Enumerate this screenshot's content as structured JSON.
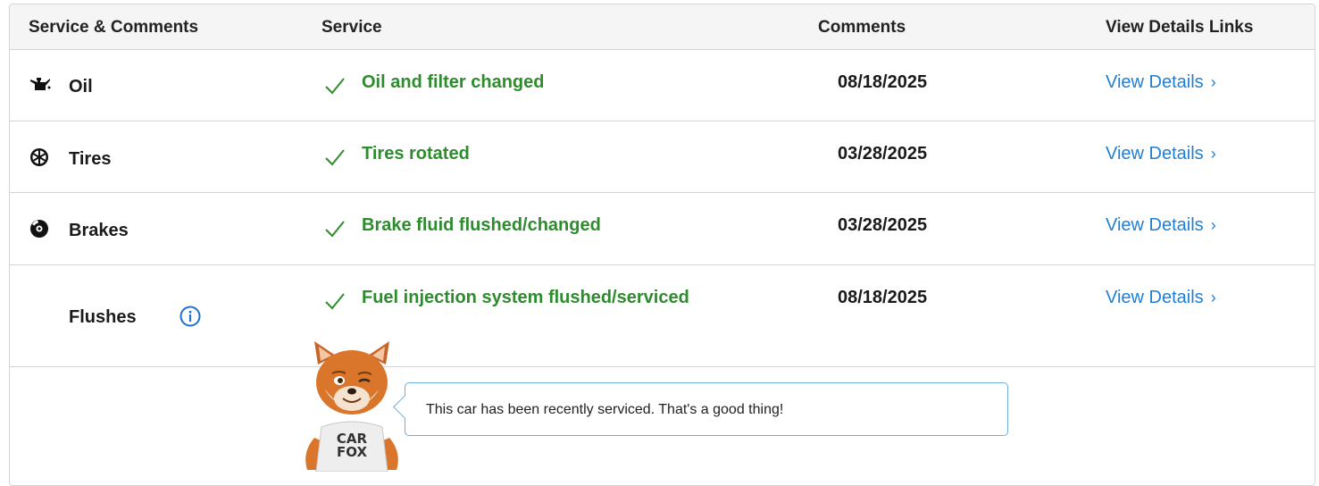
{
  "header": {
    "col1": "Service & Comments",
    "col2": "Service",
    "col3": "Comments",
    "col4": "View Details Links"
  },
  "rows": [
    {
      "category": "Oil",
      "icon": "oil-can-icon",
      "service": "Oil and filter changed",
      "date": "08/18/2025",
      "link": "View Details"
    },
    {
      "category": "Tires",
      "icon": "tire-icon",
      "service": "Tires rotated",
      "date": "03/28/2025",
      "link": "View Details"
    },
    {
      "category": "Brakes",
      "icon": "brake-disc-icon",
      "service": "Brake fluid flushed/changed",
      "date": "03/28/2025",
      "link": "View Details"
    },
    {
      "category": "Flushes",
      "icon": "info-icon",
      "service": "Fuel injection system flushed/serviced",
      "date": "08/18/2025",
      "link": "View Details"
    }
  ],
  "mascot": {
    "shirt_line1": "CAR",
    "shirt_line2": "FOX",
    "message": "This car has been recently serviced. That's a good thing!"
  },
  "colors": {
    "service_green": "#2e8b2e",
    "link_blue": "#1f7fd6",
    "bubble_border": "#6aaee3",
    "header_bg": "#f5f5f5",
    "border": "#d4d4d4"
  },
  "link_chevron": "›"
}
